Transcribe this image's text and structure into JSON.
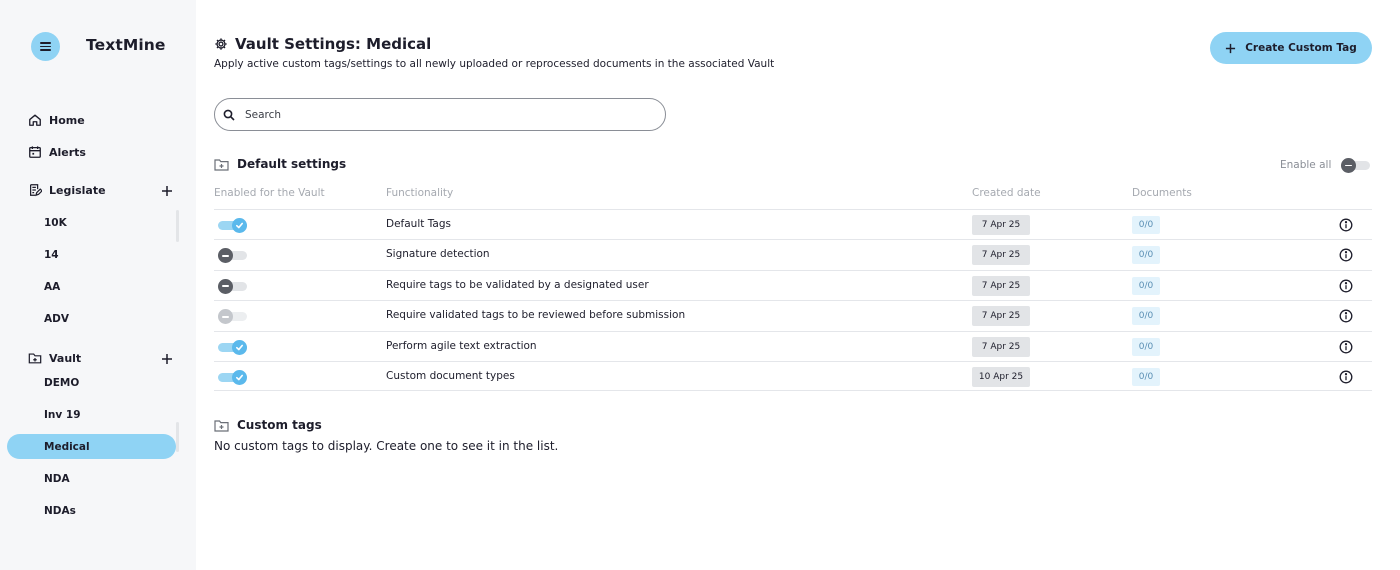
{
  "app": {
    "brand": "TextMine"
  },
  "sidebar": {
    "nav": [
      {
        "label": "Home",
        "icon": "home-icon"
      },
      {
        "label": "Alerts",
        "icon": "calendar-icon"
      }
    ],
    "legislate": {
      "label": "Legislate",
      "icon": "document-edit-icon",
      "items": [
        "10K",
        "14",
        "AA",
        "ADV"
      ]
    },
    "vault": {
      "label": "Vault",
      "icon": "folder-add-icon",
      "items": [
        "DEMO",
        "Inv 19",
        "Medical",
        "NDA",
        "NDAs"
      ],
      "active": "Medical"
    }
  },
  "header": {
    "title": "Vault Settings: Medical",
    "subtitle": "Apply active custom tags/settings to all newly uploaded or reprocessed documents in the associated Vault",
    "create_button": "Create Custom Tag"
  },
  "search": {
    "placeholder": "Search",
    "value": ""
  },
  "default_settings": {
    "title": "Default settings",
    "enable_all_label": "Enable all",
    "enable_all_state": "off",
    "columns": [
      "Enabled for the Vault",
      "Functionality",
      "Created date",
      "Documents"
    ],
    "rows": [
      {
        "state": "on",
        "functionality": "Default Tags",
        "created": "7 Apr 25",
        "documents": "0/0"
      },
      {
        "state": "off",
        "functionality": "Signature detection",
        "created": "7 Apr 25",
        "documents": "0/0"
      },
      {
        "state": "off",
        "functionality": "Require tags to be validated by a designated user",
        "created": "7 Apr 25",
        "documents": "0/0"
      },
      {
        "state": "disabled",
        "functionality": "Require validated tags to be reviewed before submission",
        "created": "7 Apr 25",
        "documents": "0/0"
      },
      {
        "state": "on",
        "functionality": "Perform agile text extraction",
        "created": "7 Apr 25",
        "documents": "0/0"
      },
      {
        "state": "on",
        "functionality": "Custom document types",
        "created": "10 Apr 25",
        "documents": "0/0"
      }
    ]
  },
  "custom_tags": {
    "title": "Custom tags",
    "empty_message": "No custom tags to display. Create one to see it in the list."
  },
  "colors": {
    "accent": "#8fd3f4",
    "toggle_on": "#5bb9ec",
    "toggle_off": "#5b5e65",
    "sidebar_bg": "#f6f7f9"
  }
}
